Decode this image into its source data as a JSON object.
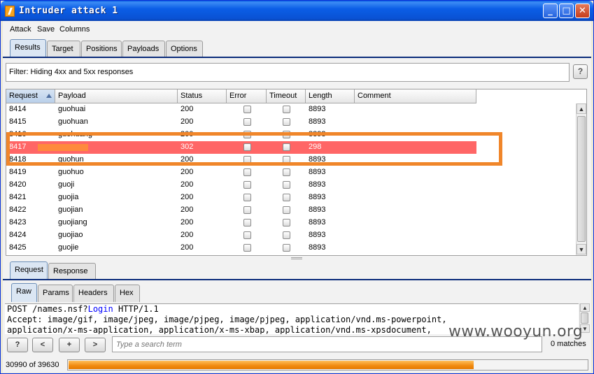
{
  "window": {
    "title": "Intruder attack 1",
    "min": "_",
    "max": "□",
    "close": "✕"
  },
  "menu": [
    "Attack",
    "Save",
    "Columns"
  ],
  "main_tabs": [
    {
      "label": "Results",
      "active": true
    },
    {
      "label": "Target",
      "active": false
    },
    {
      "label": "Positions",
      "active": false
    },
    {
      "label": "Payloads",
      "active": false
    },
    {
      "label": "Options",
      "active": false
    }
  ],
  "filter": {
    "text": "Filter:  Hiding 4xx and 5xx responses",
    "help": "?"
  },
  "table": {
    "columns": [
      "Request",
      "Payload",
      "Status",
      "Error",
      "Timeout",
      "Length",
      "Comment"
    ],
    "rows": [
      {
        "request": "8414",
        "payload": "guohuai",
        "status": "200",
        "length": "8893",
        "selected": false
      },
      {
        "request": "8415",
        "payload": "guohuan",
        "status": "200",
        "length": "8893",
        "selected": false
      },
      {
        "request": "8416",
        "payload": "guohuang",
        "status": "200",
        "length": "8893",
        "selected": false
      },
      {
        "request": "8417",
        "payload": "",
        "status": "302",
        "length": "298",
        "selected": true
      },
      {
        "request": "8418",
        "payload": "guohun",
        "status": "200",
        "length": "8893",
        "selected": false
      },
      {
        "request": "8419",
        "payload": "guohuo",
        "status": "200",
        "length": "8893",
        "selected": false
      },
      {
        "request": "8420",
        "payload": "guoji",
        "status": "200",
        "length": "8893",
        "selected": false
      },
      {
        "request": "8421",
        "payload": "guojia",
        "status": "200",
        "length": "8893",
        "selected": false
      },
      {
        "request": "8422",
        "payload": "guojian",
        "status": "200",
        "length": "8893",
        "selected": false
      },
      {
        "request": "8423",
        "payload": "guojiang",
        "status": "200",
        "length": "8893",
        "selected": false
      },
      {
        "request": "8424",
        "payload": "guojiao",
        "status": "200",
        "length": "8893",
        "selected": false
      },
      {
        "request": "8425",
        "payload": "guojie",
        "status": "200",
        "length": "8893",
        "selected": false
      }
    ]
  },
  "detail_tabs": [
    {
      "label": "Request",
      "active": true
    },
    {
      "label": "Response",
      "active": false
    }
  ],
  "view_tabs": [
    {
      "label": "Raw",
      "active": true
    },
    {
      "label": "Params",
      "active": false
    },
    {
      "label": "Headers",
      "active": false
    },
    {
      "label": "Hex",
      "active": false
    }
  ],
  "editor": {
    "line1_a": "POST /names.nsf?",
    "line1_kw": "Login",
    "line1_b": " HTTP/1.1",
    "line2": "Accept: image/gif, image/jpeg, image/pjpeg, image/pjpeg, application/vnd.ms-powerpoint,",
    "line3": "application/x-ms-application, application/x-ms-xbap, application/vnd.ms-xpsdocument,"
  },
  "search": {
    "help": "?",
    "prev": "<",
    "add": "+",
    "next": ">",
    "placeholder": "Type a search term",
    "matches": "0 matches"
  },
  "progress": {
    "label": "30990 of 39630",
    "done": 30990,
    "total": 39630
  },
  "watermark": "www.wooyun.org",
  "colors": {
    "selected_row": "#ff6666",
    "highlight_border": "#f0862a",
    "progress": "#f08a10"
  }
}
